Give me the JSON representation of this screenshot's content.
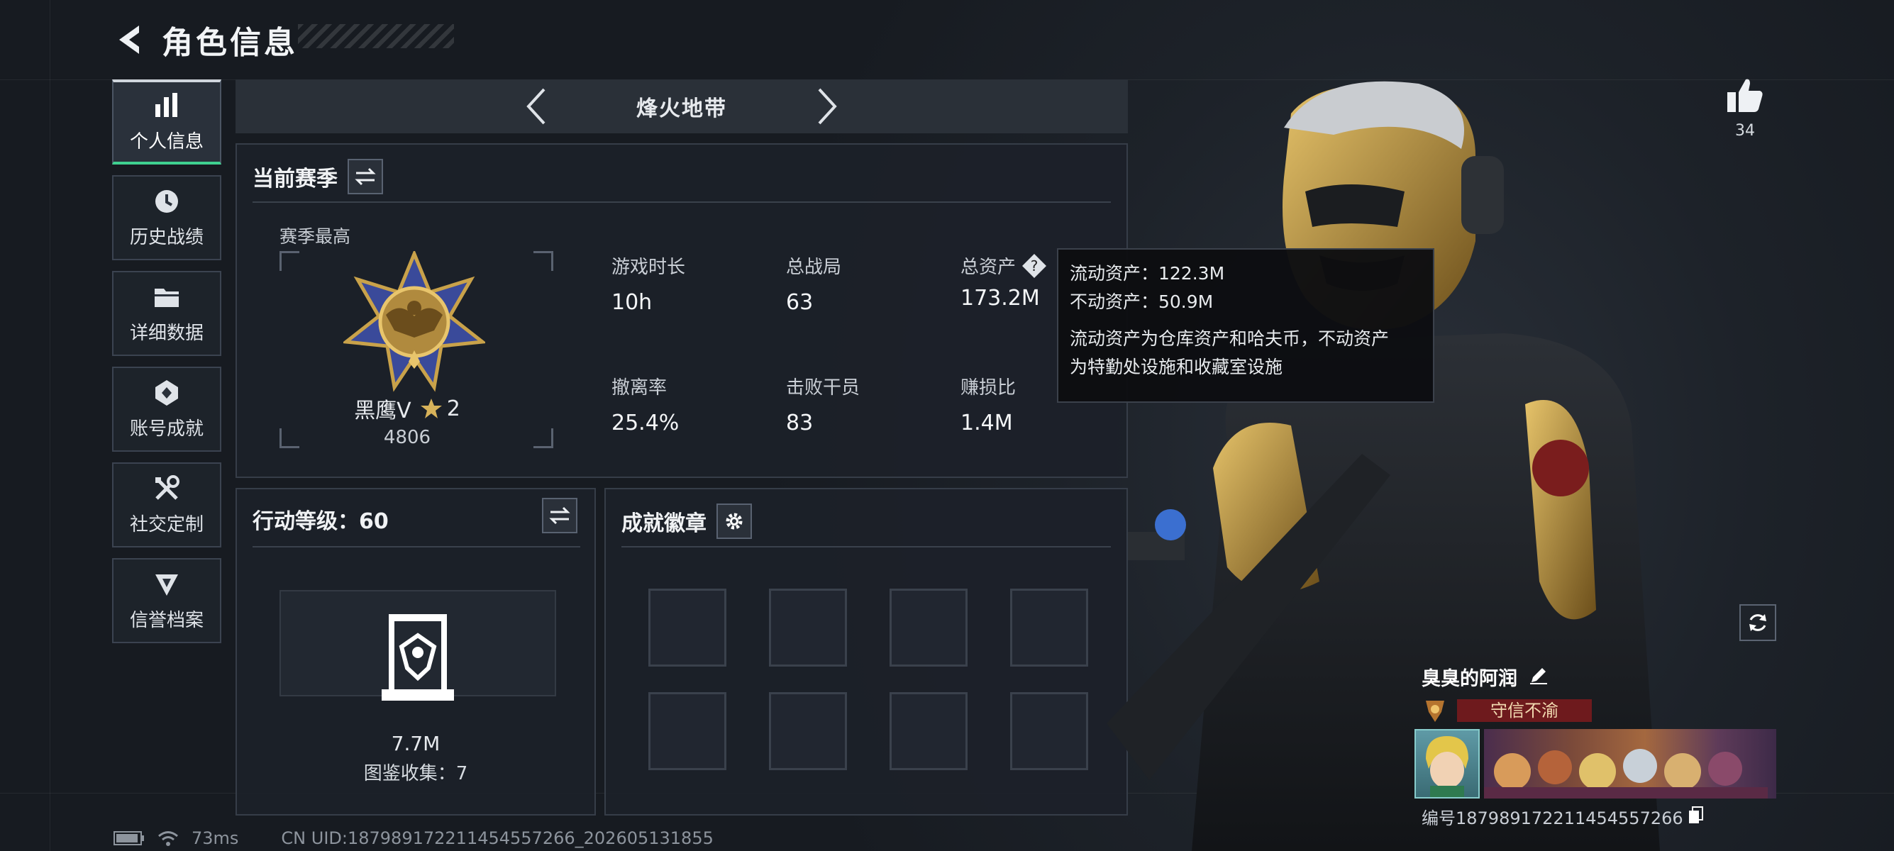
{
  "header": {
    "title": "角色信息"
  },
  "sidebar": {
    "items": [
      {
        "label": "个人信息",
        "icon": "bar-chart-icon",
        "active": true
      },
      {
        "label": "历史战绩",
        "icon": "clock-icon"
      },
      {
        "label": "详细数据",
        "icon": "folder-icon"
      },
      {
        "label": "账号成就",
        "icon": "achievement-icon"
      },
      {
        "label": "社交定制",
        "icon": "tools-icon"
      },
      {
        "label": "信誉档案",
        "icon": "reputation-icon"
      }
    ]
  },
  "mode": {
    "title": "烽火地带"
  },
  "season": {
    "title": "当前赛季",
    "best_label": "赛季最高",
    "rank_name": "黑鹰Ⅴ",
    "rank_stars": "2",
    "rank_score": "4806",
    "stats": [
      {
        "label": "游戏时长",
        "value": "10h"
      },
      {
        "label": "总战局",
        "value": "63"
      },
      {
        "label": "总资产",
        "value": "173.2M"
      },
      {
        "label": "撤离率",
        "value": "25.4%"
      },
      {
        "label": "击败干员",
        "value": "83"
      },
      {
        "label": "赚损比",
        "value": "1.4M"
      }
    ]
  },
  "tooltip": {
    "liquid": "流动资产：122.3M",
    "fixed": "不动资产：50.9M",
    "desc1": "流动资产为仓库资产和哈夫币，不动资产",
    "desc2": "为特勤处设施和收藏室设施"
  },
  "action_level": {
    "title": "行动等级：60",
    "value": "7.7M",
    "collection": "图鉴收集：7"
  },
  "badges": {
    "title": "成就徽章"
  },
  "like": {
    "count": "34"
  },
  "profile": {
    "name": "臭臭的阿润",
    "title": "守信不渝",
    "id": "编号187989172211454557266"
  },
  "status": {
    "ping": "73ms",
    "uid": "CN UID:187989172211454557266_202605131855"
  },
  "colors": {
    "accent": "#3fd190",
    "title_red": "#6e1a1d",
    "gold": "#c9a24a"
  }
}
